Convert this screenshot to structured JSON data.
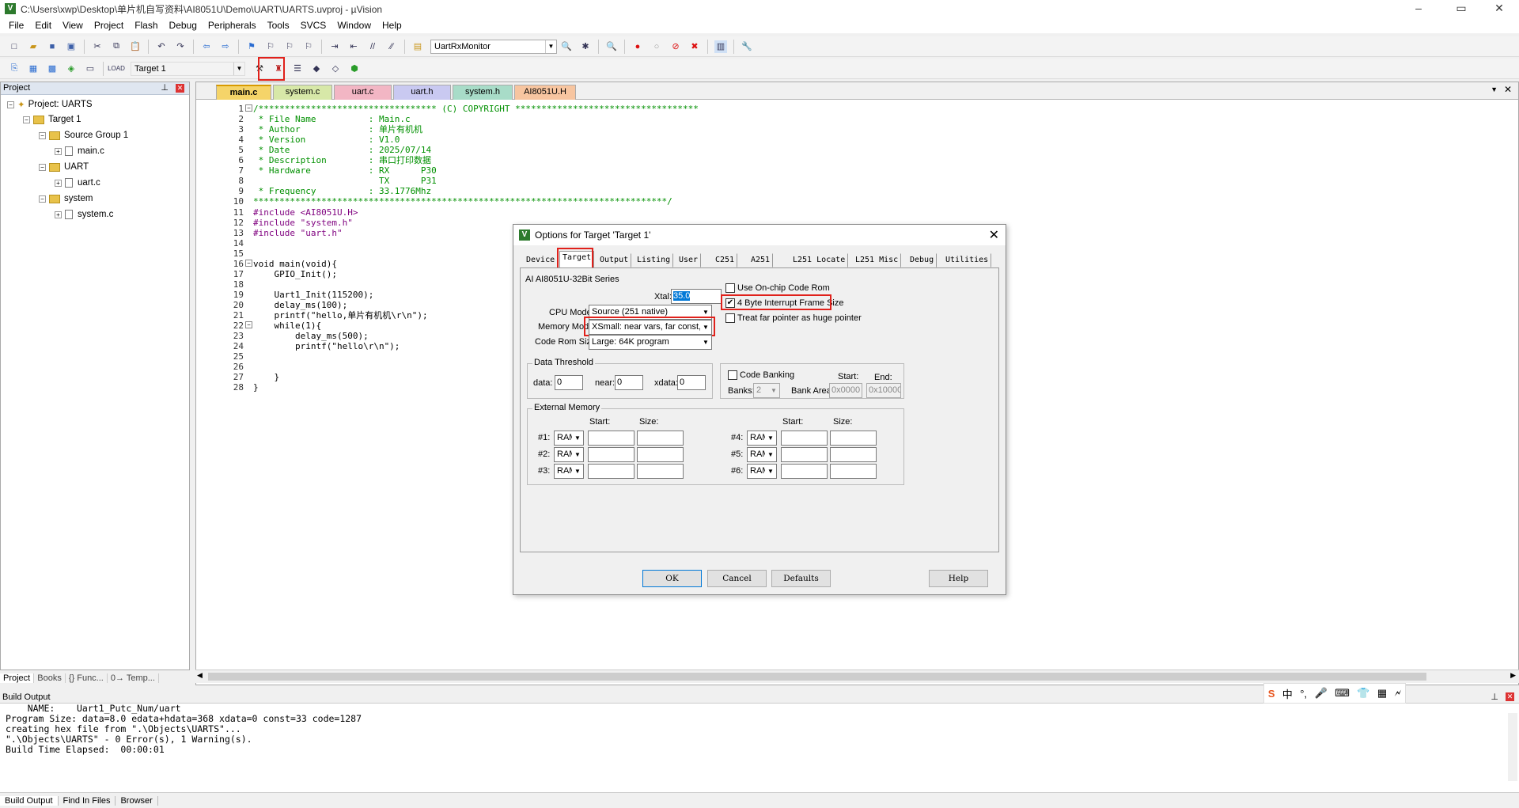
{
  "window": {
    "title": "C:\\Users\\xwp\\Desktop\\单片机自写资料\\AI8051U\\Demo\\UART\\UARTS.uvproj - µVision",
    "controls": [
      "–",
      "▭",
      "✕"
    ]
  },
  "menu": [
    "File",
    "Edit",
    "View",
    "Project",
    "Flash",
    "Debug",
    "Peripherals",
    "Tools",
    "SVCS",
    "Window",
    "Help"
  ],
  "toolbar1": {
    "target_combo": "UartRxMonitor"
  },
  "toolbar2": {
    "target_combo": "Target 1"
  },
  "project_pane": {
    "header": "Project",
    "tree": [
      {
        "label": "Project: UARTS",
        "level": 0
      },
      {
        "label": "Target 1",
        "level": 1
      },
      {
        "label": "Source Group 1",
        "level": 2
      },
      {
        "label": "main.c",
        "level": 3
      },
      {
        "label": "UART",
        "level": 2
      },
      {
        "label": "uart.c",
        "level": 3
      },
      {
        "label": "system",
        "level": 2
      },
      {
        "label": "system.c",
        "level": 3
      }
    ],
    "tabs": [
      "Project",
      "Books",
      "{} Func...",
      "0→ Temp..."
    ]
  },
  "editor": {
    "tabs": [
      {
        "label": "main.c",
        "color": "#f5d469"
      },
      {
        "label": "system.c",
        "color": "#d7e8a8"
      },
      {
        "label": "uart.c",
        "color": "#f2b6c4"
      },
      {
        "label": "uart.h",
        "color": "#c9c9f1"
      },
      {
        "label": "system.h",
        "color": "#a8dcc8"
      },
      {
        "label": "AI8051U.H",
        "color": "#f7c5a0"
      }
    ],
    "line_numbers": [
      "1",
      "2",
      "3",
      "4",
      "5",
      "6",
      "7",
      "8",
      "9",
      "10",
      "11",
      "12",
      "13",
      "14",
      "15",
      "16",
      "17",
      "18",
      "19",
      "20",
      "21",
      "22",
      "23",
      "24",
      "25",
      "26",
      "27",
      "28"
    ],
    "lines": [
      "/********************************** (C) COPYRIGHT ***********************************",
      " * File Name          : Main.c",
      " * Author             : 单片有机机",
      " * Version            : V1.0",
      " * Date               : 2025/07/14",
      " * Description        : 串口打印数据",
      " * Hardware           : RX      P30",
      "                        TX      P31",
      " * Frequency          : 33.1776Mhz",
      "*******************************************************************************/",
      "#include <AI8051U.H>",
      "#include \"system.h\"",
      "#include \"uart.h\"",
      "",
      "",
      "void main(void){",
      "    GPIO_Init();",
      "",
      "    Uart1_Init(115200);",
      "    delay_ms(100);",
      "    printf(\"hello,单片有机机\\r\\n\");",
      "    while(1){",
      "        delay_ms(500);",
      "        printf(\"hello\\r\\n\");",
      "",
      "",
      "    }",
      "}"
    ]
  },
  "build_output": {
    "header": "Build Output",
    "lines": [
      "    NAME:    Uart1_Putc_Num/uart",
      "Program Size: data=8.0 edata+hdata=368 xdata=0 const=33 code=1287",
      "creating hex file from \".\\Objects\\UARTS\"...",
      "\".\\Objects\\UARTS\" - 0 Error(s), 1 Warning(s).",
      "Build Time Elapsed:  00:00:01"
    ],
    "tabs": [
      "Build Output",
      "Find In Files",
      "Browser"
    ]
  },
  "ime_bar": [
    "S",
    "中",
    "°,",
    "🎤",
    "⌨",
    "👕",
    "▦",
    "🗲"
  ],
  "dialog": {
    "title": "Options for Target 'Target 1'",
    "tabs": [
      "Device",
      "Target",
      "Output",
      "Listing",
      "User",
      "C251",
      "A251",
      "L251 Locate",
      "L251 Misc",
      "Debug",
      "Utilities"
    ],
    "active_tab": "Target",
    "device_name": "AI AI8051U-32Bit Series",
    "xtal_label": "Xtal:",
    "xtal_value": "35.0",
    "cpu_mode_label": "CPU Mode:",
    "cpu_mode_value": "Source (251 native)",
    "memory_model_label": "Memory Model:",
    "memory_model_value": "XSmall: near vars, far const, ptr-4",
    "code_rom_label": "Code Rom Size:",
    "code_rom_value": "Large: 64K program",
    "use_onchip_label": "Use On-chip Code Rom",
    "use_onchip_checked": false,
    "interrupt_frame_label": "4 Byte Interrupt Frame Size",
    "interrupt_frame_checked": true,
    "far_pointer_label": "Treat far pointer as huge pointer",
    "far_pointer_checked": false,
    "data_threshold": {
      "title": "Data Threshold",
      "data_label": "data:",
      "data_value": "0",
      "near_label": "near:",
      "near_value": "0",
      "xdata_label": "xdata:",
      "xdata_value": "0"
    },
    "code_banking": {
      "label": "Code Banking",
      "banks_label": "Banks:",
      "banks_value": "2",
      "bank_area_label": "Bank Area:",
      "start_label": "Start:",
      "start_value": "0x0000",
      "end_label": "End:",
      "end_value": "0x10000"
    },
    "external_memory": {
      "title": "External Memory",
      "start_label": "Start:",
      "size_label": "Size:",
      "rows": [
        {
          "label": "#1:",
          "type": "RAM"
        },
        {
          "label": "#2:",
          "type": "RAM"
        },
        {
          "label": "#3:",
          "type": "RAM"
        },
        {
          "label": "#4:",
          "type": "RAM"
        },
        {
          "label": "#5:",
          "type": "RAM"
        },
        {
          "label": "#6:",
          "type": "RAM"
        }
      ]
    },
    "buttons": {
      "ok": "OK",
      "cancel": "Cancel",
      "defaults": "Defaults",
      "help": "Help"
    }
  }
}
